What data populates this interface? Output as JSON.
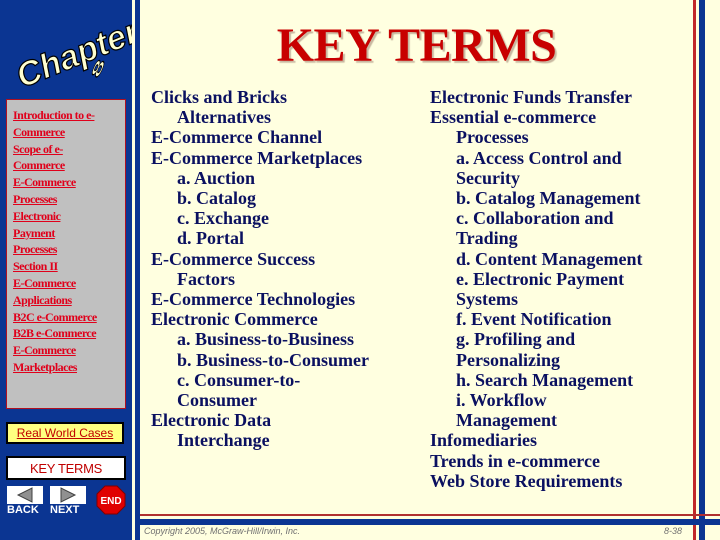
{
  "sidebar": {
    "logo": {
      "word": "Chapter",
      "number": "8"
    },
    "nav_links": [
      "Introduction to e-",
      "Commerce",
      "Scope of e-",
      "Commerce",
      "E-Commerce",
      "Processes",
      "Electronic",
      "Payment",
      "Processes",
      "Section II",
      "E-Commerce",
      "Applications",
      "B2C e-Commerce",
      "B2B e-Commerce",
      "E-Commerce",
      "Marketplaces"
    ],
    "real_world_cases_label": "Real World Cases",
    "key_terms_label": "KEY TERMS",
    "back_label": "BACK",
    "next_label": "NEXT",
    "end_label": "END"
  },
  "slide": {
    "title": "KEY TERMS",
    "left_column": [
      {
        "text": "Clicks and Bricks",
        "indent": false
      },
      {
        "text": "Alternatives",
        "indent": true
      },
      {
        "text": "E-Commerce Channel",
        "indent": false
      },
      {
        "text": "E-Commerce Marketplaces",
        "indent": false
      },
      {
        "text": "a. Auction",
        "indent": true
      },
      {
        "text": "b. Catalog",
        "indent": true
      },
      {
        "text": "c. Exchange",
        "indent": true
      },
      {
        "text": "d. Portal",
        "indent": true
      },
      {
        "text": "E-Commerce Success",
        "indent": false
      },
      {
        "text": "Factors",
        "indent": true
      },
      {
        "text": "E-Commerce Technologies",
        "indent": false
      },
      {
        "text": "Electronic Commerce",
        "indent": false
      },
      {
        "text": "a. Business-to-Business",
        "indent": true
      },
      {
        "text": "b. Business-to-Consumer",
        "indent": true
      },
      {
        "text": "c. Consumer-to-",
        "indent": true
      },
      {
        "text": "Consumer",
        "indent": true
      },
      {
        "text": "Electronic Data",
        "indent": false
      },
      {
        "text": "Interchange",
        "indent": true
      }
    ],
    "right_column": [
      {
        "text": "Electronic Funds Transfer",
        "indent": false
      },
      {
        "text": "Essential e-commerce",
        "indent": false
      },
      {
        "text": "Processes",
        "indent": true
      },
      {
        "text": "a. Access Control and",
        "indent": true
      },
      {
        "text": "Security",
        "indent": true
      },
      {
        "text": "b. Catalog Management",
        "indent": true
      },
      {
        "text": "c. Collaboration and",
        "indent": true
      },
      {
        "text": "Trading",
        "indent": true
      },
      {
        "text": "d. Content Management",
        "indent": true
      },
      {
        "text": "e. Electronic Payment",
        "indent": true
      },
      {
        "text": "Systems",
        "indent": true
      },
      {
        "text": "f. Event Notification",
        "indent": true
      },
      {
        "text": "g. Profiling and",
        "indent": true
      },
      {
        "text": "Personalizing",
        "indent": true
      },
      {
        "text": "h. Search Management",
        "indent": true
      },
      {
        "text": "i. Workflow",
        "indent": true
      },
      {
        "text": "Management",
        "indent": true
      },
      {
        "text": "Infomediaries",
        "indent": false
      },
      {
        "text": "Trends in e-commerce",
        "indent": false
      },
      {
        "text": "Web Store Requirements",
        "indent": false
      }
    ]
  },
  "footer": {
    "copyright": "Copyright 2005, McGraw-Hill/Irwin, Inc.",
    "page": "8-38"
  },
  "colors": {
    "sidebar_blue": "#0b3592",
    "title_red": "#c80000",
    "link_red": "#e0001b",
    "term_navy": "#0a1060",
    "background": "#ffffe0"
  }
}
